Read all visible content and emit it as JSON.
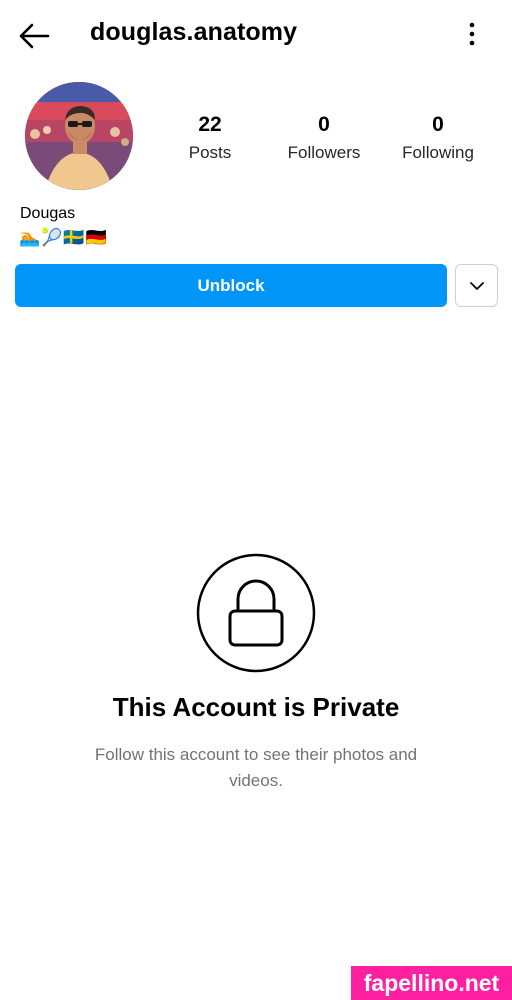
{
  "header": {
    "username": "douglas.anatomy"
  },
  "profile": {
    "stats": [
      {
        "value": "22",
        "label": "Posts"
      },
      {
        "value": "0",
        "label": "Followers"
      },
      {
        "value": "0",
        "label": "Following"
      }
    ],
    "display_name": "Dougas",
    "bio_emojis": "🏊🎾🇸🇪🇩🇪"
  },
  "actions": {
    "unblock_label": "Unblock"
  },
  "private_notice": {
    "title": "This Account is Private",
    "subtitle": "Follow this account to see their photos and videos."
  },
  "watermark": "fapellino.net",
  "colors": {
    "primary_button": "#0095f6",
    "watermark_bg": "#ff1fa1"
  }
}
